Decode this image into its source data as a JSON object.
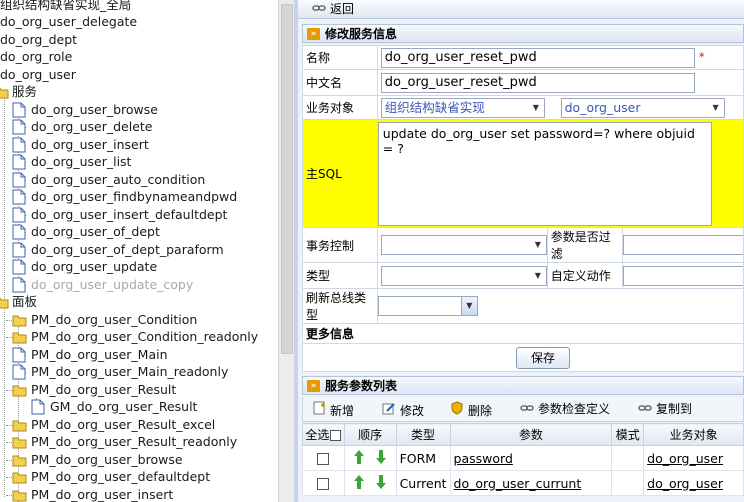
{
  "tree": {
    "nodes": [
      {
        "label": "组织结构缺省实现_全局",
        "muted": false
      },
      {
        "label": "do_org_user_delegate",
        "muted": false
      },
      {
        "label": "do_org_dept",
        "muted": false
      },
      {
        "label": "do_org_role",
        "muted": false
      },
      {
        "label": "do_org_user",
        "muted": false
      },
      {
        "label": "服务",
        "muted": false
      },
      {
        "label": "do_org_user_browse",
        "muted": false
      },
      {
        "label": "do_org_user_delete",
        "muted": false
      },
      {
        "label": "do_org_user_insert",
        "muted": false
      },
      {
        "label": "do_org_user_list",
        "muted": false
      },
      {
        "label": "do_org_user_auto_condition",
        "muted": false
      },
      {
        "label": "do_org_user_findbynameandpwd",
        "muted": false
      },
      {
        "label": "do_org_user_insert_defaultdept",
        "muted": false
      },
      {
        "label": "do_org_user_of_dept",
        "muted": false
      },
      {
        "label": "do_org_user_of_dept_paraform",
        "muted": false
      },
      {
        "label": "do_org_user_update",
        "muted": false
      },
      {
        "label": "do_org_user_update_copy",
        "muted": true
      },
      {
        "label": "面板",
        "muted": false
      },
      {
        "label": "PM_do_org_user_Condition",
        "muted": false
      },
      {
        "label": "PM_do_org_user_Condition_readonly",
        "muted": false
      },
      {
        "label": "PM_do_org_user_Main",
        "muted": false
      },
      {
        "label": "PM_do_org_user_Main_readonly",
        "muted": false
      },
      {
        "label": "PM_do_org_user_Result",
        "muted": false
      },
      {
        "label": "GM_do_org_user_Result",
        "muted": false
      },
      {
        "label": "PM_do_org_user_Result_excel",
        "muted": false
      },
      {
        "label": "PM_do_org_user_Result_readonly",
        "muted": false
      },
      {
        "label": "PM_do_org_user_browse",
        "muted": false
      },
      {
        "label": "PM_do_org_user_defaultdept",
        "muted": false
      },
      {
        "label": "PM_do_org_user_insert",
        "muted": false
      }
    ]
  },
  "toolbar": {
    "back_label": "返回"
  },
  "edit_section": {
    "title": "修改服务信息",
    "name_label": "名称",
    "name_value": "do_org_user_reset_pwd",
    "required_mark": "*",
    "cn_name_label": "中文名",
    "cn_name_value": "do_org_user_reset_pwd",
    "biz_object_label": "业务对象",
    "biz_object_impl": "组织结构缺省实现",
    "biz_object_value": "do_org_user",
    "main_sql_label": "主SQL",
    "main_sql_value": "update do_org_user set password=? where objuid = ?",
    "tx_control_label": "事务控制",
    "param_filter_label": "参数是否过滤",
    "type_label": "类型",
    "custom_action_label": "自定义动作",
    "refresh_bus_label": "刷新总线类型",
    "more_info_label": "更多信息",
    "save_label": "保存"
  },
  "params_section": {
    "title": "服务参数列表",
    "toolbar": {
      "add": "新增",
      "edit": "修改",
      "delete": "删除",
      "param_check": "参数检查定义",
      "copy_to": "复制到"
    },
    "columns": {
      "select_all": "全选",
      "order": "顺序",
      "type": "类型",
      "param": "参数",
      "mode": "模式",
      "biz_object": "业务对象"
    },
    "rows": [
      {
        "type": "FORM",
        "param": "password",
        "mode": "",
        "biz_object": "do_org_user"
      },
      {
        "type": "Current",
        "param": "do_org_user_currunt",
        "mode": "",
        "biz_object": "do_org_user"
      }
    ]
  },
  "colors": {
    "sql_highlight": "#ffff00",
    "section_arrow": "#e69a00",
    "required": "#e0201f",
    "panel_bg": "#eef2f8"
  }
}
